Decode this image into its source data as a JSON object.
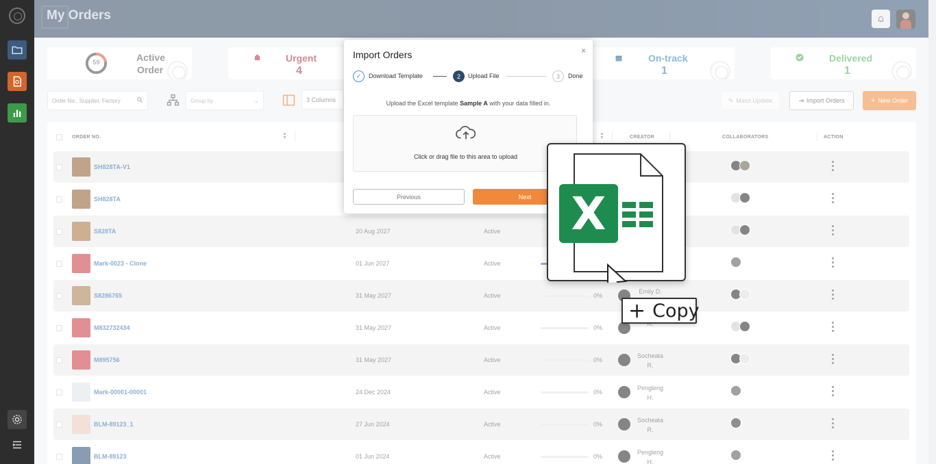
{
  "page": {
    "title": "My Orders"
  },
  "stats": {
    "active": {
      "ring_value": "59",
      "label_line1": "Active",
      "label_line2": "Order"
    },
    "urgent": {
      "label": "Urgent",
      "value": "4"
    },
    "ontrack": {
      "label": "On-track",
      "value": "1"
    },
    "delivered": {
      "label": "Delivered",
      "value": "1"
    }
  },
  "toolbar": {
    "search_placeholder": "Order No., Supplier, Factory",
    "group_placeholder": "Group by",
    "columns_label": "3 Columns",
    "mass_update_label": "Mass Update",
    "import_label": "Import Orders",
    "new_order_label": "New Order"
  },
  "table": {
    "headers": {
      "order_no": "ORDER NO.",
      "creator": "CREATOR",
      "collaborators": "COLLABORATORS",
      "action": "ACTION"
    },
    "rows": [
      {
        "order": "SH828TA-V1",
        "date": "",
        "status": "",
        "progress": "",
        "progress_fill": 0,
        "creator_l1": "",
        "creator_l2": ""
      },
      {
        "order": "SH828TA",
        "date": "",
        "status": "",
        "progress": "",
        "progress_fill": 0,
        "creator_l1": "",
        "creator_l2": ""
      },
      {
        "order": "S828TA",
        "date": "20 Aug 2027",
        "status": "Active",
        "progress": "",
        "progress_fill": 0,
        "creator_l1": "",
        "creator_l2": ""
      },
      {
        "order": "Mark-0023 - Clone",
        "date": "01 Jun 2027",
        "status": "Active",
        "progress": "",
        "progress_fill": 0.15,
        "creator_l1": "",
        "creator_l2": ""
      },
      {
        "order": "S8286765",
        "date": "31 May 2027",
        "status": "Active",
        "progress": "0%",
        "progress_fill": 0,
        "creator_l1": "Emily D.",
        "creator_l2": ""
      },
      {
        "order": "M832732434",
        "date": "31 May 2027",
        "status": "Active",
        "progress": "0%",
        "progress_fill": 0,
        "creator_l1": "",
        "creator_l2": "R."
      },
      {
        "order": "M895756",
        "date": "31 May 2027",
        "status": "Active",
        "progress": "0%",
        "progress_fill": 0,
        "creator_l1": "Socheata",
        "creator_l2": "R."
      },
      {
        "order": "Mark-00001-00001",
        "date": "24 Dec 2024",
        "status": "Active",
        "progress": "0%",
        "progress_fill": 0,
        "creator_l1": "Pengleng",
        "creator_l2": "H."
      },
      {
        "order": "BLM-89123_1",
        "date": "27 Jun 2024",
        "status": "Active",
        "progress": "0%",
        "progress_fill": 0,
        "creator_l1": "Socheata",
        "creator_l2": "R."
      },
      {
        "order": "BLM-89123",
        "date": "01 Jun 2024",
        "status": "Active",
        "progress": "0%",
        "progress_fill": 0,
        "creator_l1": "Pengleng",
        "creator_l2": "H."
      }
    ]
  },
  "modal": {
    "title": "Import Orders",
    "close": "×",
    "steps": [
      {
        "num": "✓",
        "label": "Download Template"
      },
      {
        "num": "2",
        "label": "Upload File"
      },
      {
        "num": "3",
        "label": "Done"
      }
    ],
    "desc_pre": "Upload the Excel template",
    "desc_bold": "Sample A",
    "desc_post": "with your data filled in.",
    "dropzone_text": "Click or drag file to this area to upload",
    "previous_label": "Previous",
    "next_label": "Next"
  },
  "overlay_graphic": {
    "excel_letter": "X",
    "copy_text": "Copy",
    "plus": "+"
  },
  "colors": {
    "accent_orange": "#f0893c",
    "urgent": "#b3263c",
    "ontrack": "#2a7fb8",
    "delivered": "#4caf50",
    "excel_green": "#1e8c4e",
    "link_blue": "#2a6fb3"
  }
}
